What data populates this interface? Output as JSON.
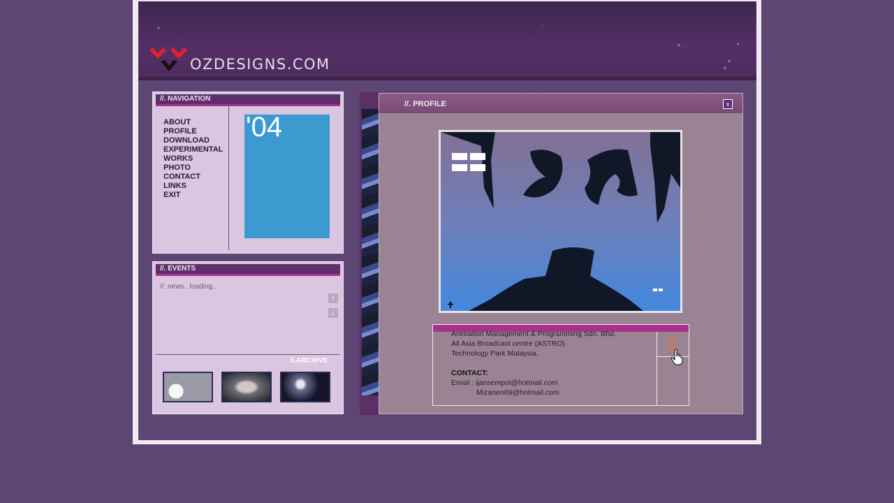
{
  "site": {
    "logo_text": "OZDESIGNS.COM"
  },
  "navigation": {
    "title": "//. NAVIGATION",
    "items": [
      "ABOUT",
      "PROFILE",
      "DOWNLOAD",
      "EXPERIMENTAL",
      "WORKS",
      "PHOTO",
      "CONTACT",
      "LINKS",
      "EXIT"
    ],
    "year": "'04"
  },
  "events": {
    "title": "//. EVENTS",
    "status": "//. news.. loading..",
    "archive_label": "//.ARCHIVE"
  },
  "profile": {
    "title": "//. PROFILE",
    "close_label": "x",
    "lines": [
      "Animation Management & Programming Sdn. Bhd.",
      "All Asia Broadcast centre (ASTRO)",
      "Technology Park Malaysia."
    ],
    "contact_heading": "CONTACT:",
    "email_line": "Email : ijansempoi@hotmail.com",
    "email_line_2": "Mizanen69@hotmail.com"
  },
  "colors": {
    "accent": "#a8318d",
    "background": "#5e4674",
    "year_box": "#3b9bd1"
  },
  "icons": [
    "logo-mark-icon",
    "scroll-up-icon",
    "scroll-down-icon",
    "close-icon",
    "hand-cursor-icon"
  ]
}
